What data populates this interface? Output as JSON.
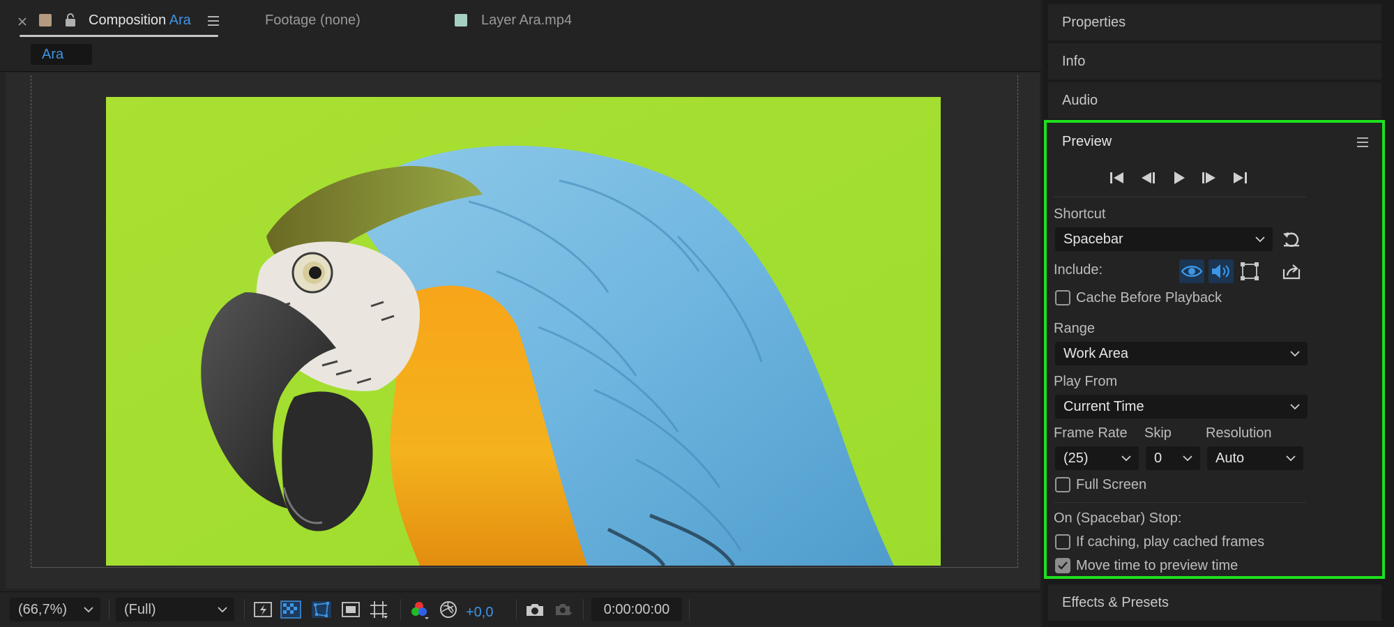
{
  "composition_panel": {
    "tabs": {
      "composition_prefix": "Composition",
      "composition_name": "Ara",
      "footage": "Footage (none)",
      "layer": "Layer Ara.mp4"
    },
    "comp_chip": "Ara",
    "bottom_bar": {
      "zoom": "(66,7%)",
      "resolution": "(Full)",
      "exposure": "+0,0",
      "timecode": "0:00:00:00"
    }
  },
  "right_panels": {
    "properties": "Properties",
    "info": "Info",
    "audio": "Audio",
    "effects": "Effects & Presets"
  },
  "preview": {
    "title": "Preview",
    "shortcut_label": "Shortcut",
    "shortcut_value": "Spacebar",
    "include_label": "Include:",
    "cache_before_playback": "Cache Before Playback",
    "range_label": "Range",
    "range_value": "Work Area",
    "play_from_label": "Play From",
    "play_from_value": "Current Time",
    "frame_rate_label": "Frame Rate",
    "frame_rate_value": "(25)",
    "skip_label": "Skip",
    "skip_value": "0",
    "resolution_label": "Resolution",
    "resolution_value": "Auto",
    "full_screen": "Full Screen",
    "on_stop_label": "On (Spacebar) Stop:",
    "if_caching": "If caching, play cached frames",
    "move_time": "Move time to preview time",
    "cache_before_playback_checked": false,
    "full_screen_checked": false,
    "if_caching_checked": false,
    "move_time_checked": true
  },
  "colors": {
    "accent_blue": "#3d95e5",
    "highlight_green": "#1ee01e",
    "background_green": "#a6df2f"
  }
}
